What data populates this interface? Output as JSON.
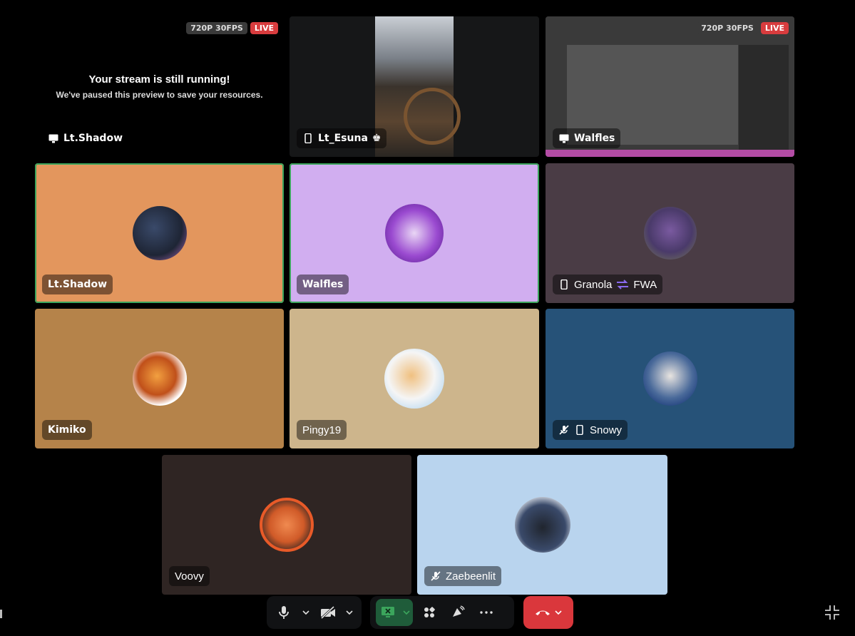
{
  "stream_preview": {
    "quality": "720P 30FPS",
    "live": "LIVE",
    "title": "Your stream is still running!",
    "subtitle": "We've paused this preview to save your resources.",
    "user": "Lt.Shadow"
  },
  "streams": {
    "esuna": {
      "user": "Lt_Esuna",
      "suffix": "♚"
    },
    "walfles": {
      "user": "Walfles",
      "quality": "720P 30FPS",
      "live": "LIVE"
    }
  },
  "participants": [
    {
      "name": "Lt.Shadow",
      "bg": "#e3965d",
      "speaking": true,
      "device": "none",
      "muted": false
    },
    {
      "name": "Walfles",
      "bg": "#d1aef0",
      "speaking": true,
      "device": "none",
      "muted": false
    },
    {
      "name": "Granola",
      "suffix": "FWA",
      "bg": "#4a3c45",
      "speaking": false,
      "device": "phone",
      "muted": false
    },
    {
      "name": "Kimiko",
      "bg": "#b5834a",
      "speaking": false,
      "device": "none",
      "muted": false
    },
    {
      "name": "Pingy19",
      "bg": "#cdb58c",
      "speaking": false,
      "device": "none",
      "muted": false
    },
    {
      "name": "Snowy",
      "bg": "#265278",
      "speaking": false,
      "device": "phone",
      "muted": true
    },
    {
      "name": "Voovy",
      "bg": "#2f2523",
      "speaking": false,
      "device": "none",
      "muted": false
    },
    {
      "name": "Zaebeenlit",
      "bg": "#b9d4ee",
      "speaking": false,
      "device": "none",
      "muted": true
    }
  ],
  "colors": {
    "accent_green": "#3ba55c",
    "hangup_red": "#da373c",
    "live_red": "#d83c3e",
    "share_green": "#1f5c3a"
  },
  "controls": {
    "icons": [
      "microphone-icon",
      "camera-off-icon",
      "screen-share-icon",
      "activities-icon",
      "soundboard-icon",
      "more-icon",
      "hang-up-icon",
      "exit-fullscreen-icon"
    ]
  }
}
